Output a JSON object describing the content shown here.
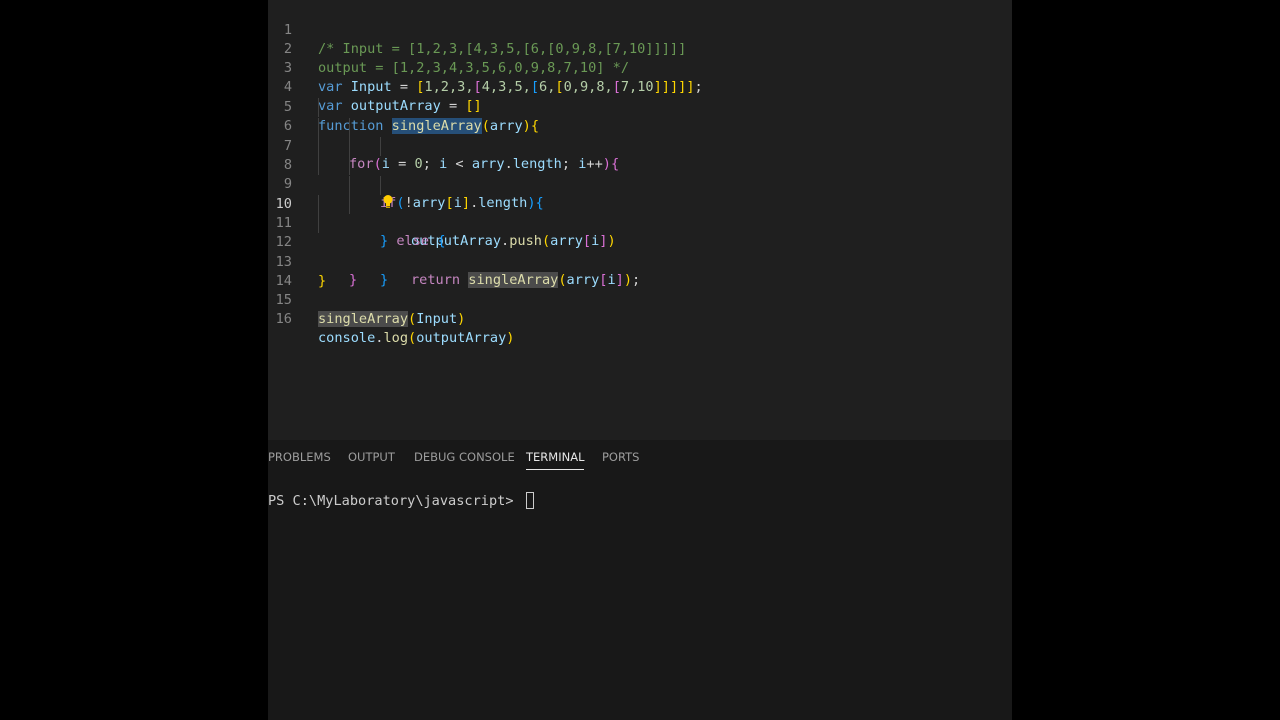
{
  "editor": {
    "line_numbers": [
      "1",
      "2",
      "3",
      "4",
      "5",
      "6",
      "7",
      "8",
      "9",
      "10",
      "11",
      "12",
      "13",
      "14",
      "15",
      "16"
    ],
    "code": {
      "l1": "/* Input = [1,2,3,[4,3,5,[6,[0,9,8,[7,10]]]]]",
      "l2": "output = [1,2,3,4,3,5,6,0,9,8,7,10] */",
      "l3": {
        "var": "var",
        "name": "Input",
        "eq": " = ",
        "b1o": "[",
        "a": "1,2,3,",
        "b2o": "[",
        "b": "4,3,5,",
        "b3o": "[",
        "c": "6,",
        "b4o": "[",
        "d": "0,9,8,",
        "b5o": "[",
        "e": "7,10",
        "closers": "]]]]]",
        "end": ";"
      },
      "l4": {
        "var": "var",
        "name": "outputArray",
        "eq": " = ",
        "arr": "[]"
      },
      "l5": {
        "kw": "function",
        "name": "singleArray",
        "open": "(",
        "param": "arry",
        "close": ")",
        "brace": "{"
      },
      "l6": {
        "kw": "for",
        "open": "(",
        "i": "i",
        "eq": " = ",
        "zero": "0",
        "semi": "; ",
        "i2": "i",
        "lt": " < ",
        "arry": "arry",
        "dot": ".",
        "len": "length",
        "semi2": "; ",
        "i3": "i",
        "inc": "++",
        "close": ")",
        "brace": "{"
      },
      "l7": {
        "kw": "if",
        "open": "(",
        "not": "!",
        "arry": "arry",
        "bo": "[",
        "i": "i",
        "bc": "]",
        "dot": ".",
        "len": "length",
        "close": ")",
        "brace": "{"
      },
      "l8": {
        "obj": "outputArray",
        "dot": ".",
        "fn": "push",
        "open": "(",
        "arry": "arry",
        "bo": "[",
        "i": "i",
        "bc": "]",
        "close": ")"
      },
      "l9": {
        "brace": "}",
        "kw": "else",
        "brace2": "{"
      },
      "l10": {
        "kw": "return",
        "fn": "singleArray",
        "open": "(",
        "arry": "arry",
        "bo": "[",
        "i": "i",
        "bc": "]",
        "close": ")",
        "end": ";"
      },
      "l11": "}",
      "l12": "}",
      "l13": "}",
      "l15": {
        "fn": "singleArray",
        "open": "(",
        "arg": "Input",
        "close": ")"
      },
      "l16": {
        "obj": "console",
        "dot": ".",
        "fn": "log",
        "open": "(",
        "arg": "outputArray",
        "close": ")"
      }
    }
  },
  "panel": {
    "tabs": [
      "PROBLEMS",
      "OUTPUT",
      "DEBUG CONSOLE",
      "TERMINAL",
      "PORTS"
    ],
    "active_tab": "TERMINAL",
    "terminal_prompt": "PS C:\\MyLaboratory\\javascript> "
  },
  "colors": {
    "background": "#1f1f1f",
    "keyword": "#569cd6",
    "control": "#c586c0",
    "function": "#dcdcaa",
    "variable": "#9cdcfe",
    "number": "#b5cea8",
    "comment": "#6a9955"
  },
  "icons": {
    "lightbulb": "lightbulb-icon"
  }
}
